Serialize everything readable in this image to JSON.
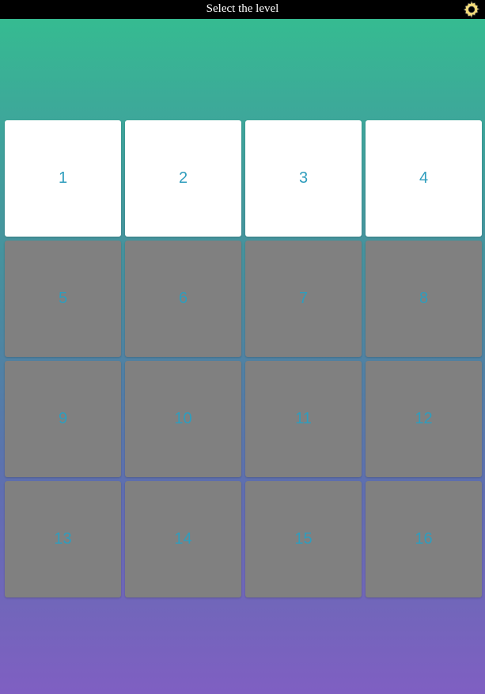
{
  "header": {
    "title": "Select the level",
    "settings_icon": "gear-icon"
  },
  "levels": [
    {
      "label": "1",
      "status": "unlocked"
    },
    {
      "label": "2",
      "status": "unlocked"
    },
    {
      "label": "3",
      "status": "unlocked"
    },
    {
      "label": "4",
      "status": "unlocked"
    },
    {
      "label": "5",
      "status": "locked"
    },
    {
      "label": "6",
      "status": "locked"
    },
    {
      "label": "7",
      "status": "locked"
    },
    {
      "label": "8",
      "status": "locked"
    },
    {
      "label": "9",
      "status": "locked"
    },
    {
      "label": "10",
      "status": "locked"
    },
    {
      "label": "11",
      "status": "locked"
    },
    {
      "label": "12",
      "status": "locked"
    },
    {
      "label": "13",
      "status": "locked"
    },
    {
      "label": "14",
      "status": "locked"
    },
    {
      "label": "15",
      "status": "locked"
    },
    {
      "label": "16",
      "status": "locked"
    }
  ],
  "colors": {
    "gradient_top": "#34bf8f",
    "gradient_bottom": "#7f5fc2",
    "unlocked_tile": "#ffffff",
    "locked_tile": "#808080",
    "level_number": "#2f9dbd",
    "header_bar": "#000000",
    "gear": "#f3dc7a"
  }
}
